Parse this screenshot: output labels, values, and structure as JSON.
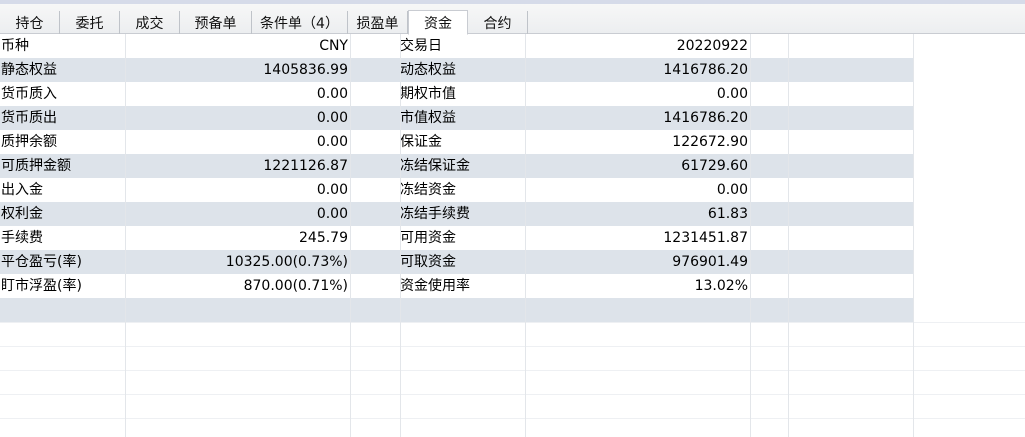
{
  "tabs": [
    {
      "label": "持仓",
      "active": false
    },
    {
      "label": "委托",
      "active": false
    },
    {
      "label": "成交",
      "active": false
    },
    {
      "label": "预备单",
      "active": false
    },
    {
      "label": "条件单（4）",
      "active": false
    },
    {
      "label": "损盈单",
      "active": false
    },
    {
      "label": "资金",
      "active": true
    },
    {
      "label": "合约",
      "active": false
    }
  ],
  "rows": [
    {
      "label1": "币种",
      "value1": "CNY",
      "label2": "交易日",
      "value2": "20220922"
    },
    {
      "label1": "静态权益",
      "value1": "1405836.99",
      "label2": "动态权益",
      "value2": "1416786.20"
    },
    {
      "label1": "货币质入",
      "value1": "0.00",
      "label2": "期权市值",
      "value2": "0.00"
    },
    {
      "label1": "货币质出",
      "value1": "0.00",
      "label2": "市值权益",
      "value2": "1416786.20"
    },
    {
      "label1": "质押余额",
      "value1": "0.00",
      "label2": "保证金",
      "value2": "122672.90"
    },
    {
      "label1": "可质押金额",
      "value1": "1221126.87",
      "label2": "冻结保证金",
      "value2": "61729.60"
    },
    {
      "label1": "出入金",
      "value1": "0.00",
      "label2": "冻结资金",
      "value2": "0.00"
    },
    {
      "label1": "权利金",
      "value1": "0.00",
      "label2": "冻结手续费",
      "value2": "61.83"
    },
    {
      "label1": "手续费",
      "value1": "245.79",
      "label2": "可用资金",
      "value2": "1231451.87"
    },
    {
      "label1": "平仓盈亏(率)",
      "value1": "10325.00(0.73%)",
      "label2": "可取资金",
      "value2": "976901.49"
    },
    {
      "label1": "盯市浮盈(率)",
      "value1": "870.00(0.71%)",
      "label2": "资金使用率",
      "value2": "13.02%"
    }
  ],
  "colors": {
    "row_alt": "#dde3ea",
    "tab_bg": "#eceef0",
    "top_strip": "#d6dbe9"
  }
}
